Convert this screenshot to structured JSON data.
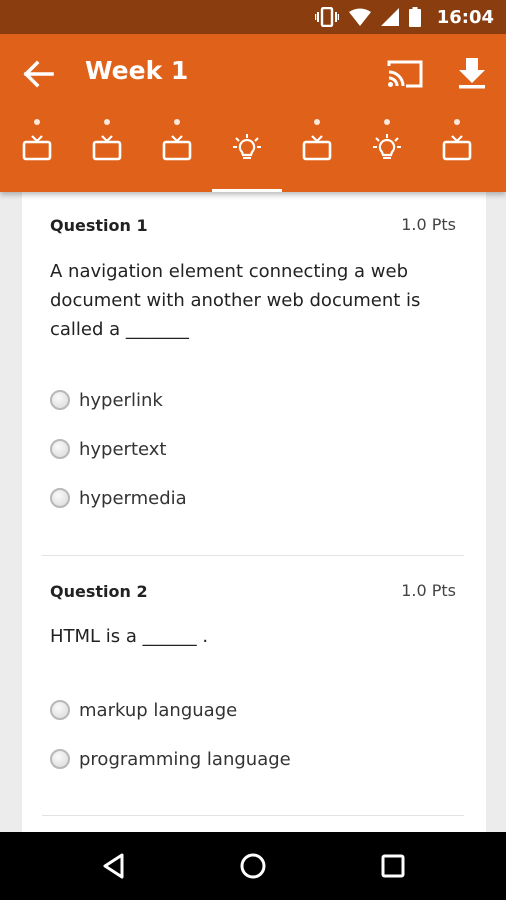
{
  "status_bar": {
    "time": "16:04",
    "icons": [
      "vibrate-icon",
      "wifi-icon",
      "signal-icon",
      "battery-icon"
    ],
    "background": "#8a3e10"
  },
  "app_bar": {
    "title": "Week 1",
    "background": "#e0621a",
    "actions": [
      "back-arrow-icon",
      "cast-icon",
      "download-icon"
    ]
  },
  "tabs": [
    {
      "icon": "tv-icon",
      "selected": false
    },
    {
      "icon": "tv-icon",
      "selected": false
    },
    {
      "icon": "tv-icon",
      "selected": false
    },
    {
      "icon": "lightbulb-icon",
      "selected": true
    },
    {
      "icon": "tv-icon",
      "selected": false
    },
    {
      "icon": "lightbulb-icon",
      "selected": false
    },
    {
      "icon": "tv-icon",
      "selected": false
    }
  ],
  "questions": [
    {
      "label": "Question 1",
      "points": "1.0 Pts",
      "text": "A navigation element connecting a web document with another web document is called a _______",
      "options": [
        "hyperlink",
        "hypertext",
        "hypermedia"
      ]
    },
    {
      "label": "Question 2",
      "points": "1.0 Pts",
      "text": "HTML is a ______ .",
      "options": [
        "markup language",
        "programming language"
      ]
    }
  ],
  "nav_bar": [
    "back-triangle-icon",
    "home-circle-icon",
    "recents-square-icon"
  ]
}
